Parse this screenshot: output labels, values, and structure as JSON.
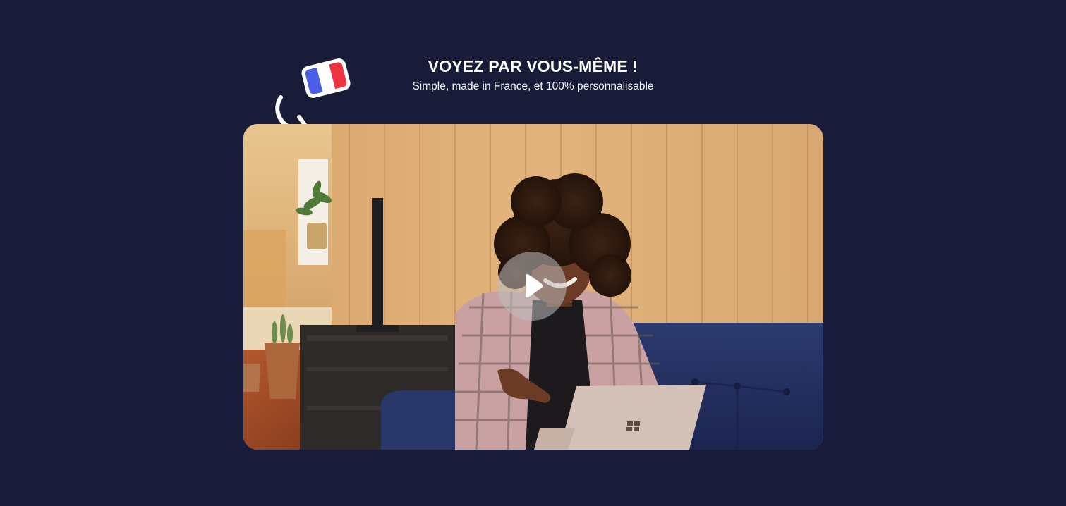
{
  "section": {
    "title": "VOYEZ PAR VOUS-MÊME !",
    "subtitle": "Simple, made in France, et 100% personnalisable"
  },
  "video": {
    "play_icon": "play-icon"
  },
  "decorations": {
    "flag_icon": "french-flag-icon",
    "arrow_icon": "curved-arrow-icon"
  },
  "colors": {
    "background": "#181c38",
    "flag_blue": "#4b5fe6",
    "flag_red": "#ef3340"
  }
}
